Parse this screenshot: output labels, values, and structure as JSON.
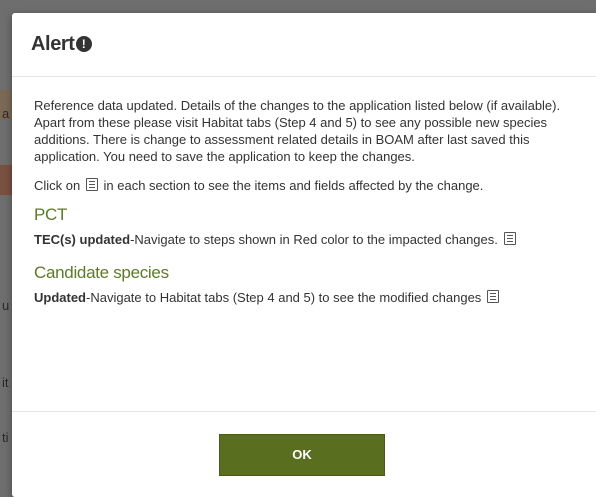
{
  "background": {
    "letters": [
      "a",
      "u",
      "it",
      "ti"
    ]
  },
  "modal": {
    "title": "Alert",
    "alert_icon": "exclamation-circle-icon",
    "intro": "Reference data updated. Details of the changes to the application listed below (if available). Apart from these please visit Habitat tabs (Step 4 and 5) to see any possible new species additions. There is change to assessment related details in BOAM after last saved this application. You need to save the application to keep the changes.",
    "hint_prefix": "Click on",
    "hint_suffix": "in each section to see the items and fields affected by the change.",
    "sections": [
      {
        "title": "PCT",
        "label": "TEC(s) updated",
        "text": "-Navigate to steps shown in Red color to the impacted changes."
      },
      {
        "title": "Candidate species",
        "label": "Updated",
        "text": "-Navigate to Habitat tabs (Step 4 and 5) to see the modified changes"
      }
    ],
    "ok_label": "OK"
  },
  "colors": {
    "accent": "#5d7a2a",
    "button": "#5a6e1f"
  }
}
